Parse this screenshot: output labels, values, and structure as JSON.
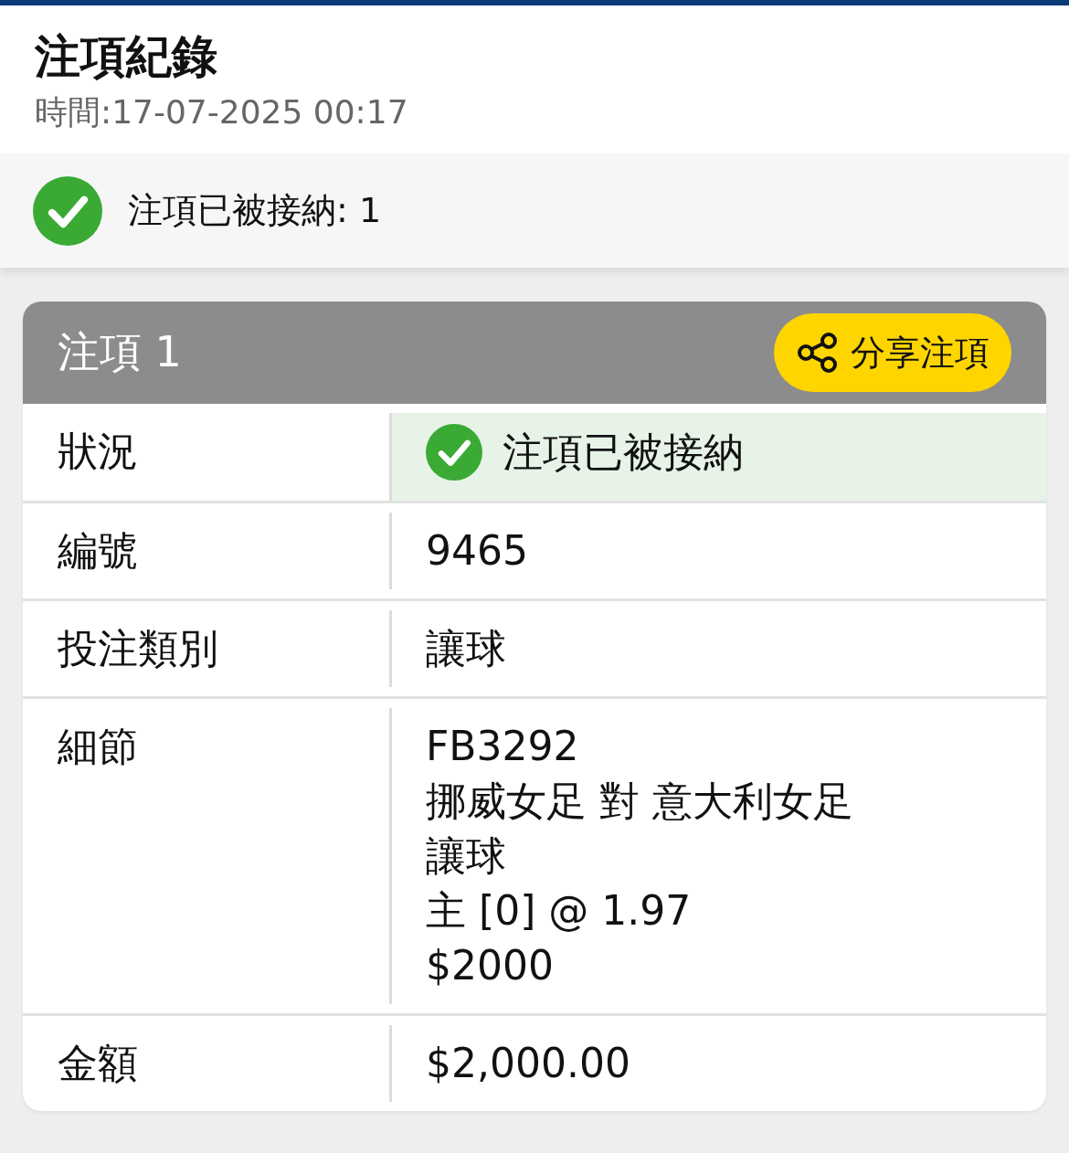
{
  "header": {
    "title": "注項紀錄",
    "time": "時間:17-07-2025 00:17"
  },
  "summary": {
    "accepted": true,
    "text": "注項已被接納: 1"
  },
  "bet": {
    "title": "注項 1",
    "share_button": "分享注項",
    "rows": [
      {
        "kind": "status",
        "label": "狀況",
        "accepted": true,
        "value": "注項已被接納"
      },
      {
        "kind": "text",
        "label": "編號",
        "value": "9465"
      },
      {
        "kind": "text",
        "label": "投注類別",
        "value": "讓球"
      },
      {
        "kind": "lines",
        "label": "細節",
        "lines": [
          "FB3292",
          "挪威女足 對 意大利女足",
          "讓球",
          "主 [0] @ 1.97",
          "$2000"
        ]
      },
      {
        "kind": "text",
        "label": "金額",
        "value": "$2,000.00"
      }
    ]
  }
}
